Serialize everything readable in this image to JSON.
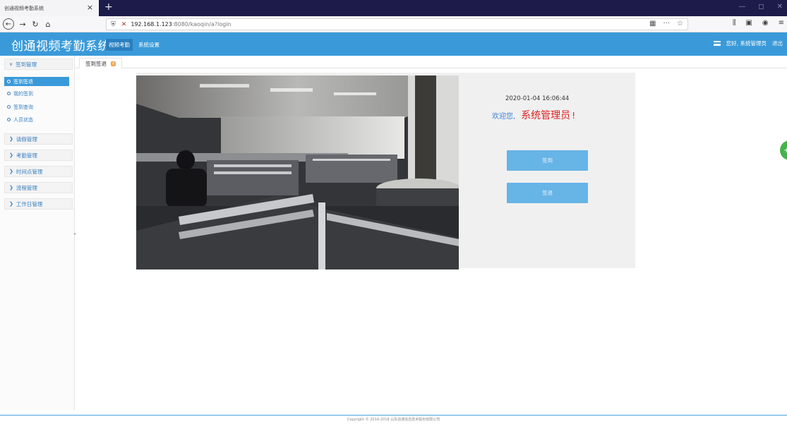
{
  "browser": {
    "tab_title": "创通视频考勤系统",
    "tab_close": "×",
    "new_tab": "+",
    "win_min": "—",
    "win_max": "◻",
    "win_close": "✕",
    "url_host": "192.168.1.123",
    "url_rest": ":8080/kaoqin/a?login",
    "nav_back": "←",
    "nav_fwd": "→",
    "nav_reload": "↻",
    "nav_home": "⌂",
    "url_qr": "▦",
    "url_more": "···",
    "url_star": "☆",
    "tb_library": "⫼",
    "tb_sidebar": "▣",
    "tb_account": "◉",
    "tb_menu": "≡"
  },
  "app": {
    "title": "创通视频考勤系统",
    "topnav": [
      "视频考勤",
      "系统设置"
    ],
    "greeting": "您好, 系统管理员",
    "logout": "退出"
  },
  "sidebar": {
    "group_signin": "签到管理",
    "items": [
      "签到签退",
      "我的签到",
      "签到查询",
      "人员状态"
    ],
    "groups": [
      "请假管理",
      "考勤管理",
      "时间点管理",
      "流程管理",
      "工作日管理"
    ]
  },
  "content_tab": {
    "label": "签到签退",
    "close": "×"
  },
  "panel": {
    "datetime": "2020-01-04 16:06:44",
    "welcome_prefix": "欢迎您,",
    "welcome_name": "系统管理员",
    "welcome_suffix": "!",
    "signin_label": "签到",
    "signout_label": "签退"
  },
  "float_badge": "+",
  "footer": {
    "copyright": "Copyright © 2014-2018 山东创通信息技术股份有限公司"
  },
  "colors": {
    "header": "#3a9ad9",
    "button": "#67b4e6",
    "welcome_name": "#e02020",
    "welcome_prefix": "#3a7fd0"
  }
}
